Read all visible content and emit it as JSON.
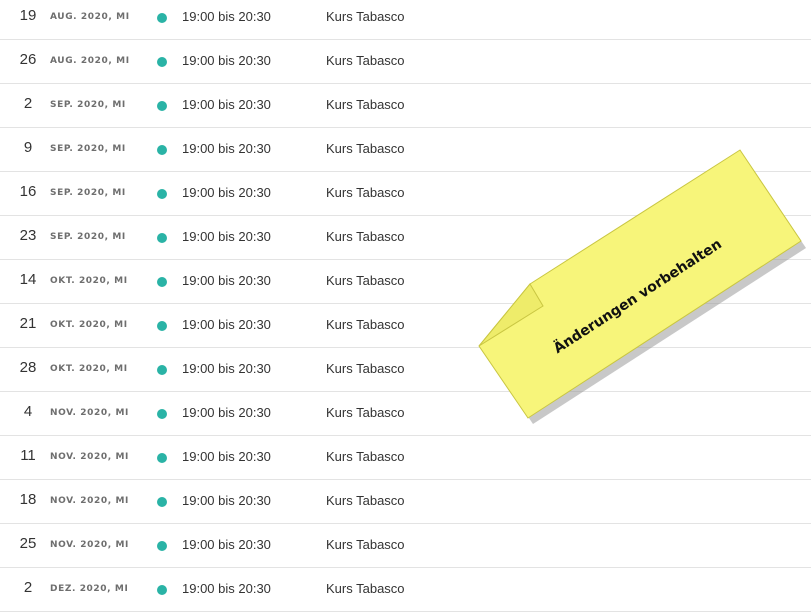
{
  "events": [
    {
      "day": "19",
      "month": "AUG. 2020, MI",
      "time": "19:00 bis 20:30",
      "title": "Kurs Tabasco"
    },
    {
      "day": "26",
      "month": "AUG. 2020, MI",
      "time": "19:00 bis 20:30",
      "title": "Kurs Tabasco"
    },
    {
      "day": "2",
      "month": "SEP. 2020, MI",
      "time": "19:00 bis 20:30",
      "title": "Kurs Tabasco"
    },
    {
      "day": "9",
      "month": "SEP. 2020, MI",
      "time": "19:00 bis 20:30",
      "title": "Kurs Tabasco"
    },
    {
      "day": "16",
      "month": "SEP. 2020, MI",
      "time": "19:00 bis 20:30",
      "title": "Kurs Tabasco"
    },
    {
      "day": "23",
      "month": "SEP. 2020, MI",
      "time": "19:00 bis 20:30",
      "title": "Kurs Tabasco"
    },
    {
      "day": "14",
      "month": "OKT. 2020, MI",
      "time": "19:00 bis 20:30",
      "title": "Kurs Tabasco"
    },
    {
      "day": "21",
      "month": "OKT. 2020, MI",
      "time": "19:00 bis 20:30",
      "title": "Kurs Tabasco"
    },
    {
      "day": "28",
      "month": "OKT. 2020, MI",
      "time": "19:00 bis 20:30",
      "title": "Kurs Tabasco"
    },
    {
      "day": "4",
      "month": "NOV. 2020, MI",
      "time": "19:00 bis 20:30",
      "title": "Kurs Tabasco"
    },
    {
      "day": "11",
      "month": "NOV. 2020, MI",
      "time": "19:00 bis 20:30",
      "title": "Kurs Tabasco"
    },
    {
      "day": "18",
      "month": "NOV. 2020, MI",
      "time": "19:00 bis 20:30",
      "title": "Kurs Tabasco"
    },
    {
      "day": "25",
      "month": "NOV. 2020, MI",
      "time": "19:00 bis 20:30",
      "title": "Kurs Tabasco"
    },
    {
      "day": "2",
      "month": "DEZ. 2020, MI",
      "time": "19:00 bis 20:30",
      "title": "Kurs Tabasco"
    }
  ],
  "note": {
    "text": "Änderungen vorbehalten",
    "color": "#f7f57a"
  },
  "colors": {
    "status_dot": "#2ab3a6"
  }
}
